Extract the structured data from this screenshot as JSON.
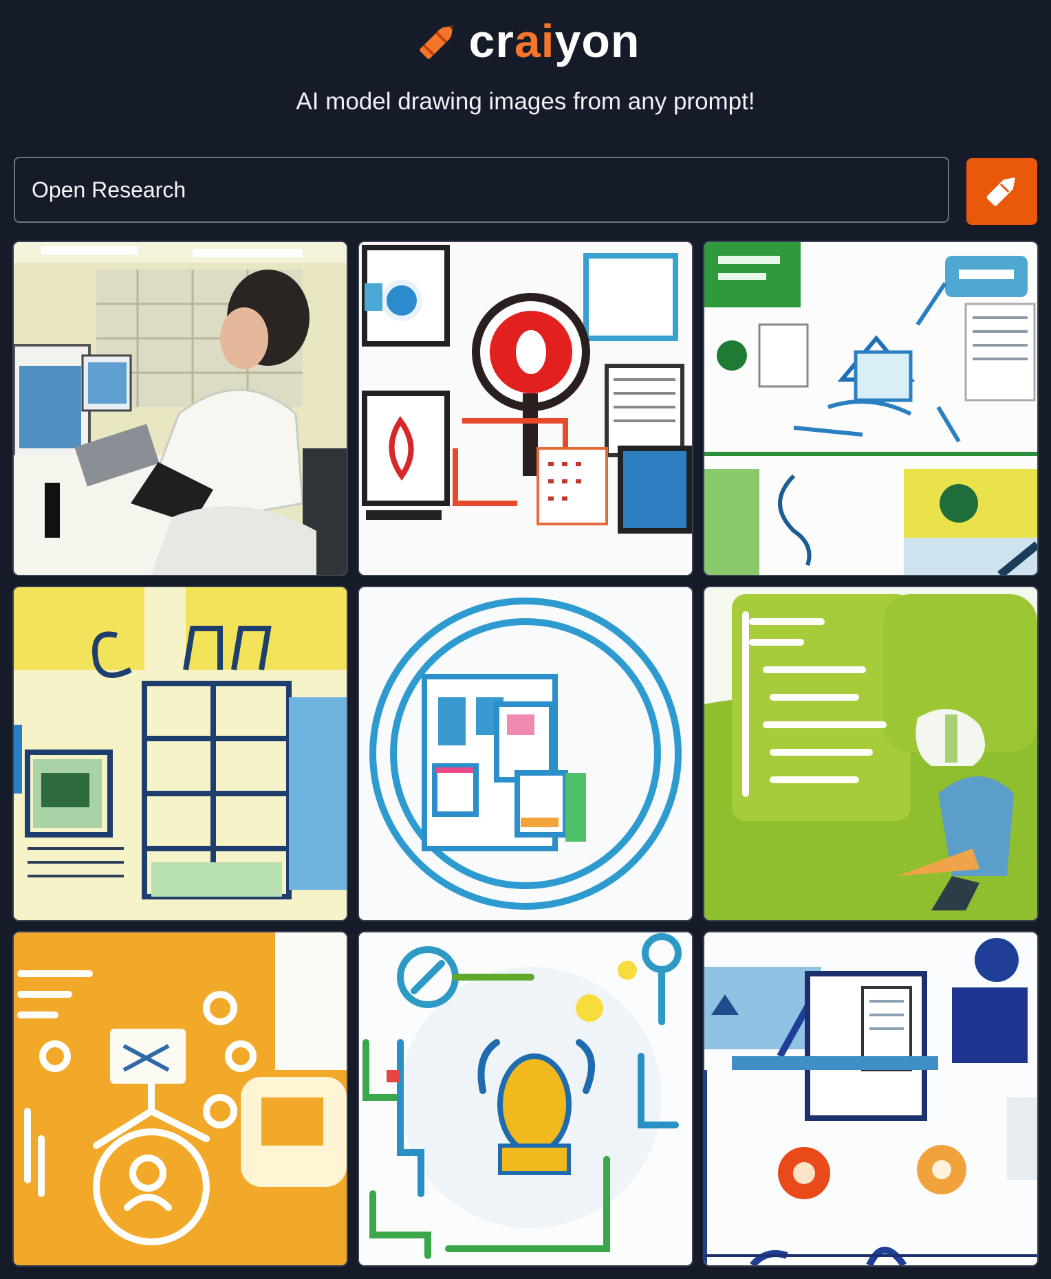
{
  "brand": {
    "name_prefix": "cr",
    "name_accent": "ai",
    "name_suffix": "yon",
    "tagline": "AI model drawing images from any prompt!",
    "accent_color": "#f5762b"
  },
  "prompt": {
    "value": "Open Research",
    "button_icon": "pencil-icon",
    "button_color": "#ea580c"
  },
  "results": {
    "count": 9,
    "images": [
      {
        "subject": "lab-researcher-at-computer"
      },
      {
        "subject": "red-magnifier-and-screens"
      },
      {
        "subject": "green-blue-lab-diagram"
      },
      {
        "subject": "yellow-lab-blueprint"
      },
      {
        "subject": "blue-circle-dashboard"
      },
      {
        "subject": "green-document-person"
      },
      {
        "subject": "orange-network-icons"
      },
      {
        "subject": "yellow-bulb-circuit"
      },
      {
        "subject": "blue-people-documents"
      }
    ]
  }
}
